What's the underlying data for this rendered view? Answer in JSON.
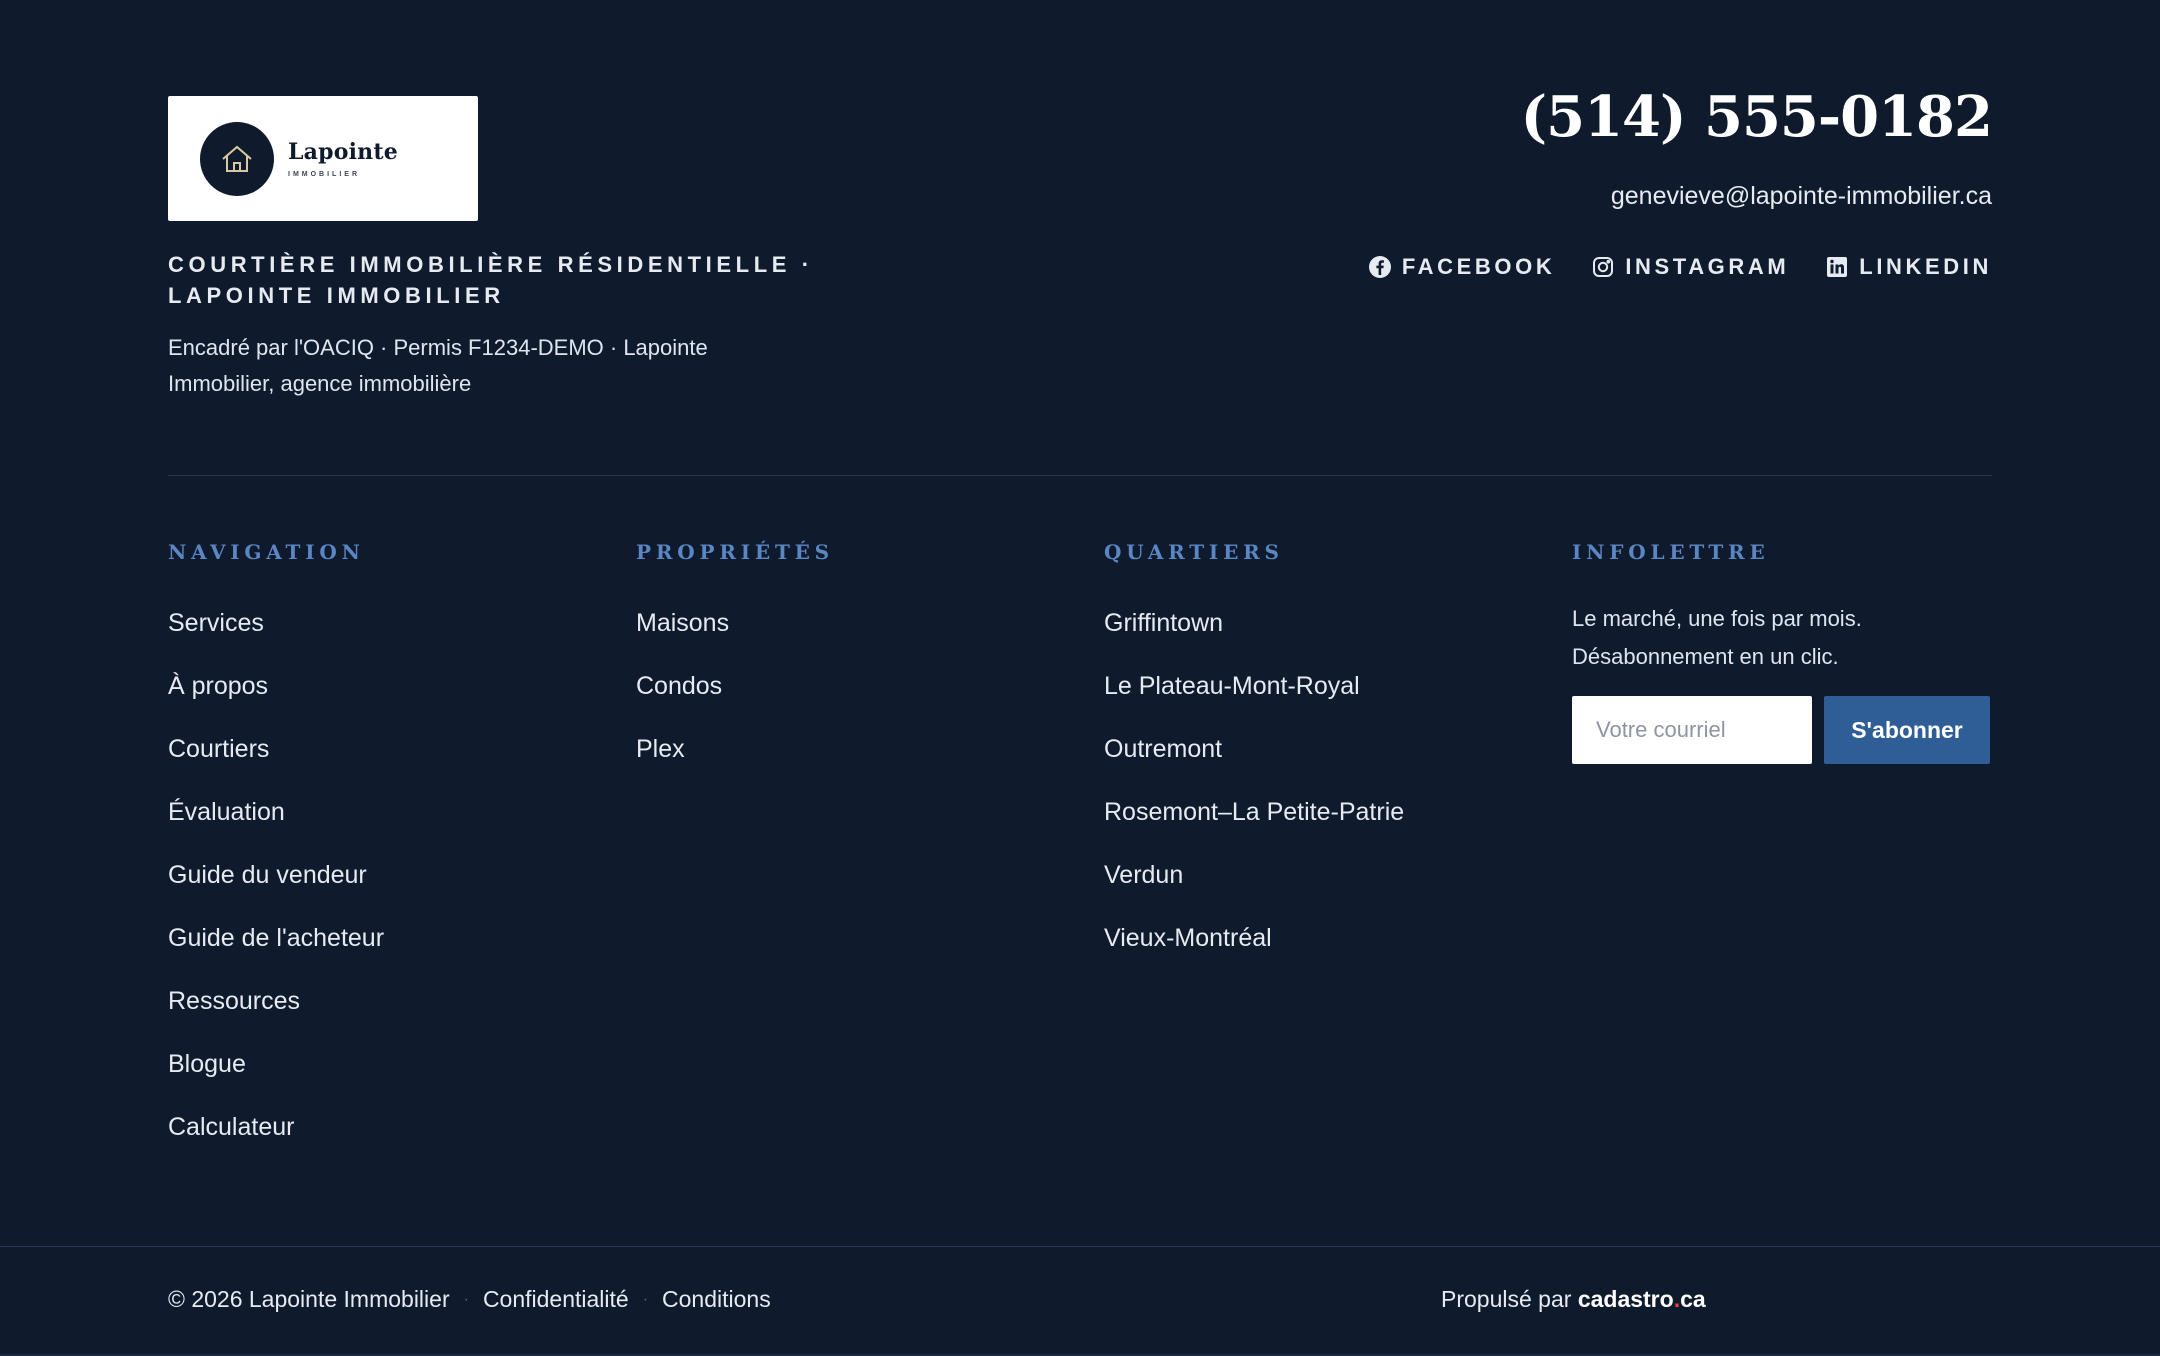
{
  "brand": {
    "logo_name": "Lapointe",
    "logo_sub": "IMMOBILIER",
    "tagline": "COURTIÈRE IMMOBILIÈRE RÉSIDENTIELLE · LAPOINTE IMMOBILIER",
    "license": "Encadré par l'OACIQ · Permis F1234-DEMO · Lapointe Immobilier, agence immobilière"
  },
  "contact": {
    "phone": "(514) 555-0182",
    "email": "genevieve@lapointe-immobilier.ca"
  },
  "socials": [
    {
      "label": "FACEBOOK",
      "icon": "facebook-icon"
    },
    {
      "label": "INSTAGRAM",
      "icon": "instagram-icon"
    },
    {
      "label": "LINKEDIN",
      "icon": "linkedin-icon"
    }
  ],
  "columns": {
    "navigation": {
      "title": "NAVIGATION",
      "items": [
        "Services",
        "À propos",
        "Courtiers",
        "Évaluation",
        "Guide du vendeur",
        "Guide de l'acheteur",
        "Ressources",
        "Blogue",
        "Calculateur"
      ]
    },
    "proprietes": {
      "title": "PROPRIÉTÉS",
      "items": [
        "Maisons",
        "Condos",
        "Plex"
      ]
    },
    "quartiers": {
      "title": "QUARTIERS",
      "items": [
        "Griffintown",
        "Le Plateau-Mont-Royal",
        "Outremont",
        "Rosemont–La Petite-Patrie",
        "Verdun",
        "Vieux-Montréal"
      ]
    },
    "infolettre": {
      "title": "INFOLETTRE",
      "text": "Le marché, une fois par mois. Désabonnement en un clic.",
      "input_placeholder": "Votre courriel",
      "button_label": "S'abonner"
    }
  },
  "bottom": {
    "copyright": "© 2026 Lapointe Immobilier",
    "separator": "·",
    "privacy": "Confidentialité",
    "terms": "Conditions",
    "powered_prefix": "Propulsé par",
    "powered_brand": "cadastro",
    "powered_dot": ".",
    "powered_tld": "ca"
  },
  "colors": {
    "background": "#0f1b2d",
    "accent": "#5b86c4",
    "button": "#2f5d96",
    "brand_dot": "#e8433a"
  }
}
